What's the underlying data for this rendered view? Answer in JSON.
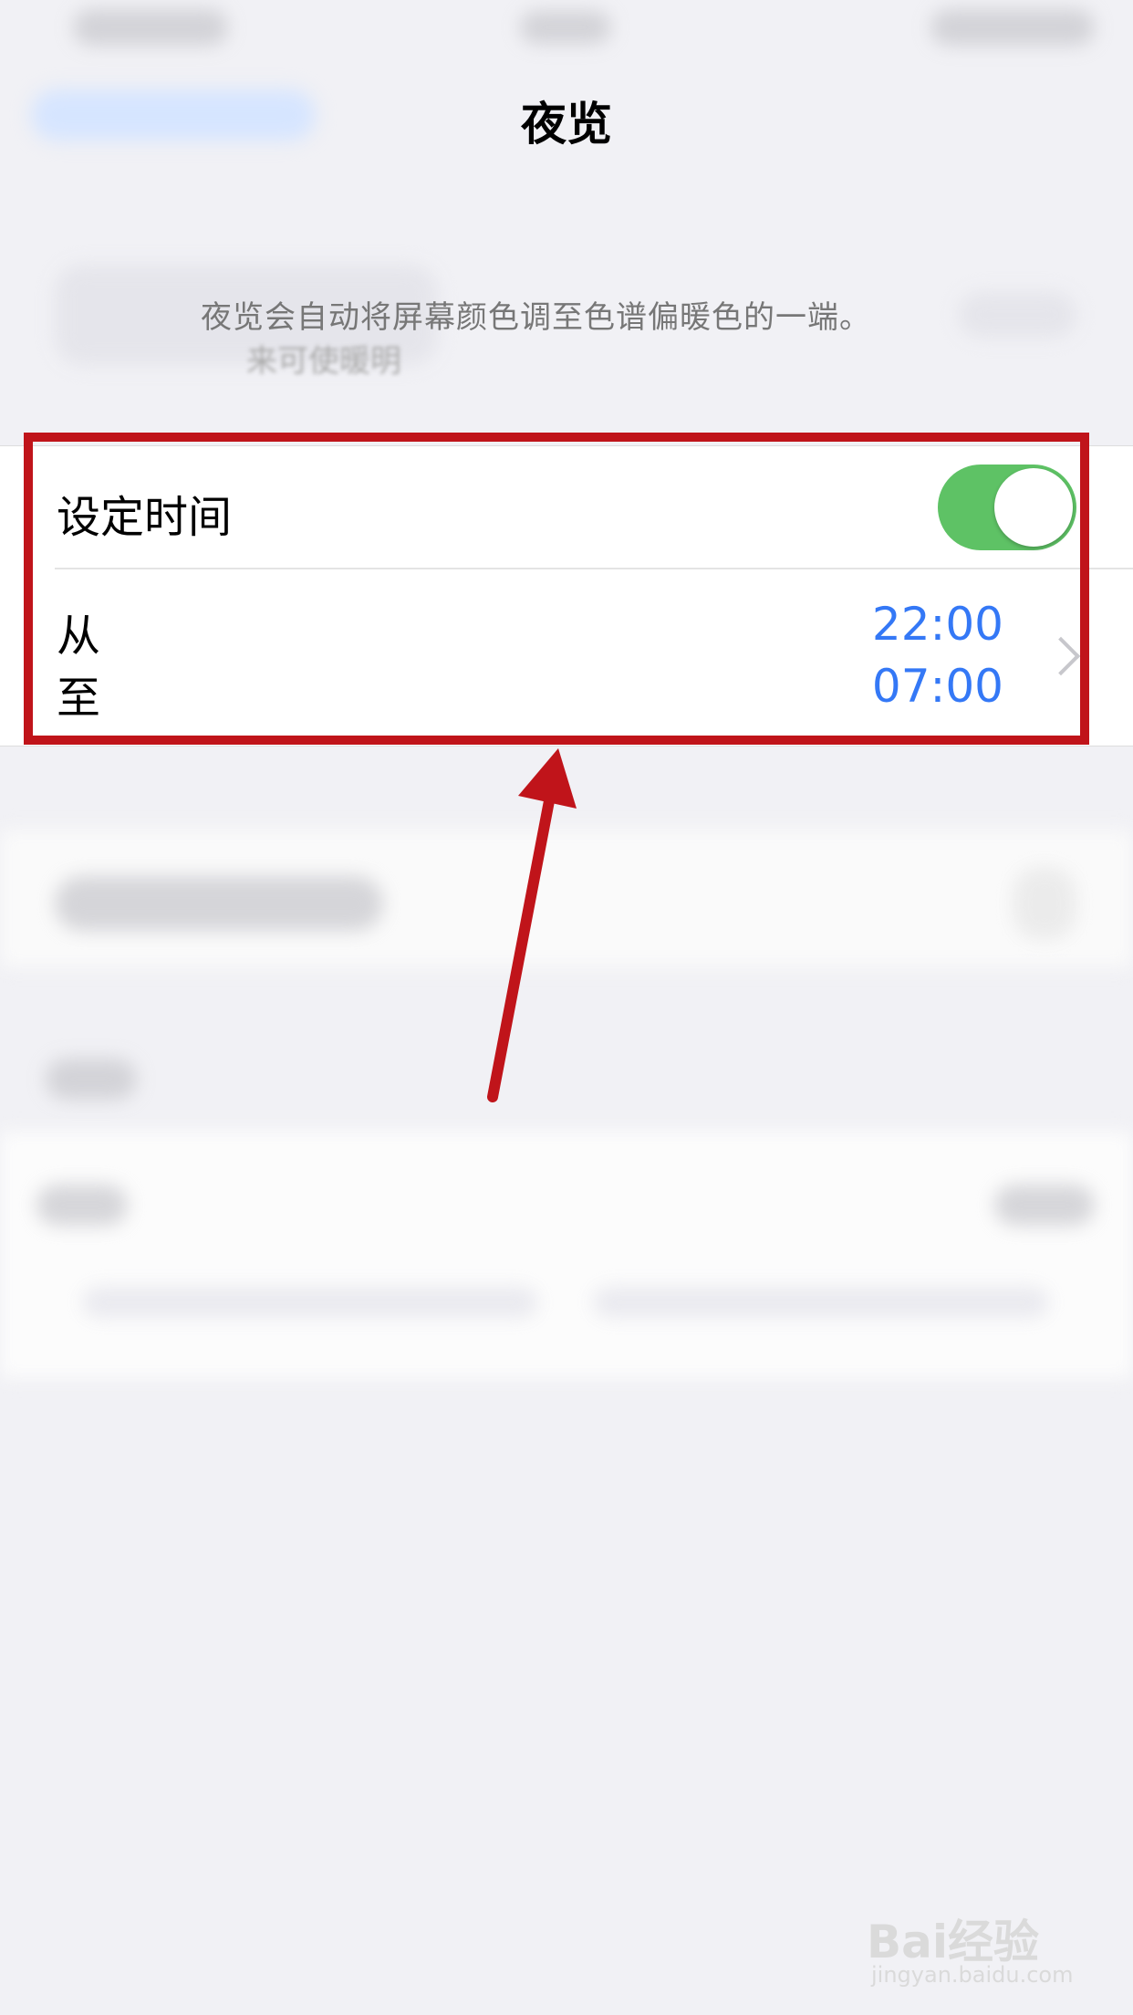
{
  "header": {
    "title": "夜览"
  },
  "description": {
    "line1": "夜览会自动将屏幕颜色调至色谱偏暖色的一端。",
    "line2": "来可使暖明"
  },
  "schedule": {
    "label": "设定时间",
    "toggle_on": true,
    "from_label": "从",
    "to_label": "至",
    "from_time": "22:00",
    "to_time": "07:00"
  },
  "watermark": {
    "brand": "Bai经验",
    "url": "jingyan.baidu.com"
  },
  "colors": {
    "accent": "#3478f6",
    "toggle": "#5ec265",
    "highlight": "#c0141a"
  }
}
